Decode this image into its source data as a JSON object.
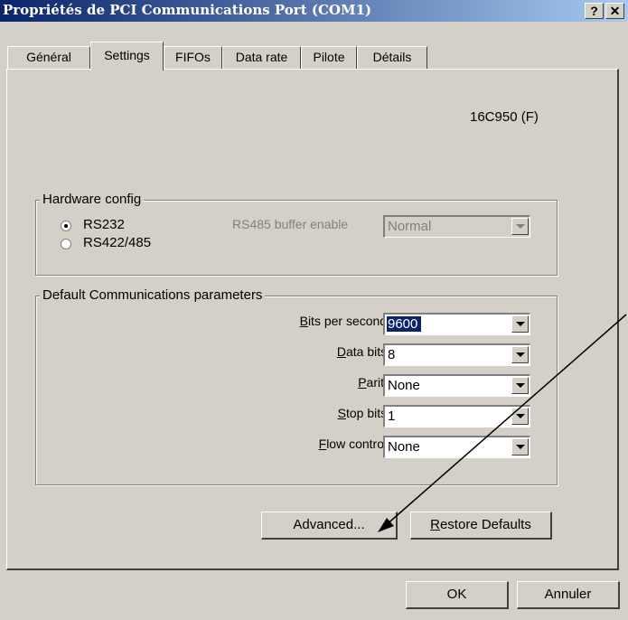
{
  "window": {
    "title": "Propriétés de PCI Communications Port (COM1)",
    "help_button": "?",
    "close_button": "✕"
  },
  "tabs": [
    {
      "label": "Général"
    },
    {
      "label": "Settings",
      "active": true
    },
    {
      "label": "FIFOs"
    },
    {
      "label": "Data rate"
    },
    {
      "label": "Pilote"
    },
    {
      "label": "Détails"
    }
  ],
  "device": {
    "chip": "16C950 (F)"
  },
  "hardware_config": {
    "legend": "Hardware config",
    "rs232_label": "RS232",
    "rs422_label": "RS422/485",
    "selected": "RS232",
    "rs485_buffer_label": "RS485 buffer enable",
    "rs485_buffer_value": "Normal"
  },
  "comm_params": {
    "legend": "Default Communications parameters",
    "bits_per_second": {
      "mnemonic": "B",
      "rest": "its per second:",
      "value": "9600"
    },
    "data_bits": {
      "mnemonic": "D",
      "rest": "ata bits:",
      "value": "8"
    },
    "parity": {
      "mnemonic": "P",
      "rest": "arity",
      "value": "None"
    },
    "stop_bits": {
      "mnemonic": "S",
      "rest": "top bits:",
      "value": "1"
    },
    "flow_control": {
      "mnemonic": "F",
      "rest": "low control:",
      "value": "None"
    }
  },
  "buttons": {
    "advanced": "Advanced...",
    "restore_mnemonic": "R",
    "restore_rest": "estore Defaults",
    "ok": "OK",
    "cancel": "Annuler"
  },
  "colors": {
    "titlebar_start": "#0a246a",
    "titlebar_end": "#a6caf0",
    "face": "#d4d0c8",
    "selection": "#0a246a",
    "outside_background": "#ffffff"
  }
}
